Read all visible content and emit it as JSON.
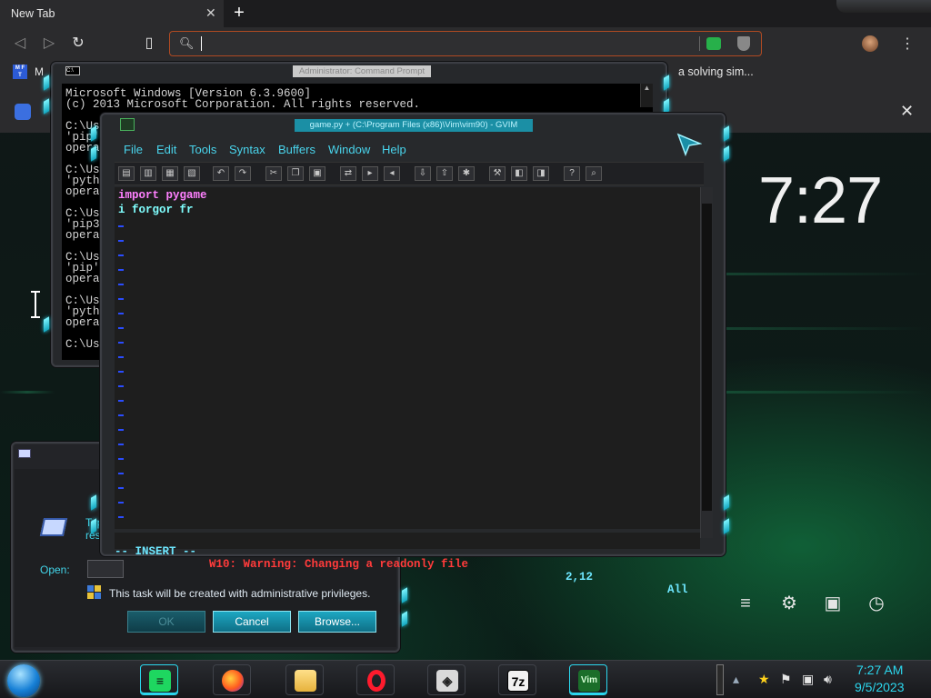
{
  "browser": {
    "tab_title": "New Tab",
    "tab_close": "✕",
    "new_tab": "+",
    "bookmark_left": "M",
    "bookmark_right": "a solving sim...",
    "ntp_close": "✕",
    "menu_dots": "⋮"
  },
  "desktop": {
    "clock": "7:27"
  },
  "cmd": {
    "title": "Administrator: Command Prompt",
    "icon_text": "C:\\",
    "lines": [
      "Microsoft Windows [Version 6.3.9600]",
      "(c) 2013 Microsoft Corporation. All rights reserved.",
      "",
      "C:\\Us",
      "'pip'",
      "opera",
      "",
      "C:\\Us",
      "'pyth",
      "opera",
      "",
      "C:\\Us",
      "'pip3",
      "opera",
      "",
      "C:\\Us",
      "'pip'",
      "opera",
      "",
      "C:\\Us",
      "'pyth",
      "opera",
      "",
      "C:\\Us"
    ]
  },
  "gvim": {
    "title": "game.py + (C:\\Program Files (x86)\\Vim\\vim90) - GVIM",
    "menu": [
      "File",
      "Edit",
      "Tools",
      "Syntax",
      "Buffers",
      "Window",
      "Help"
    ],
    "lines": [
      {
        "text": "import pygame",
        "color": "#ff80ff"
      },
      {
        "text": "i forgor fr",
        "color": "#80ffff"
      }
    ],
    "status_mode": "-- INSERT --",
    "status_warning": "W10: Warning: Changing a readonly file",
    "status_pos": "2,12",
    "status_scroll": "All"
  },
  "run_dialog": {
    "type_text_1": "Type",
    "type_text_2": "resou",
    "open_label": "Open:",
    "admin_note": "This task will be created with administrative privileges.",
    "ok": "OK",
    "cancel": "Cancel",
    "browse": "Browse..."
  },
  "taskbar": {
    "time": "7:27 AM",
    "date": "9/5/2023",
    "apps": [
      "spotify",
      "firefox",
      "file-explorer",
      "opera",
      "unity",
      "7zip",
      "vim"
    ],
    "sevenzip_label": "7z",
    "vim_label": "Vim"
  }
}
